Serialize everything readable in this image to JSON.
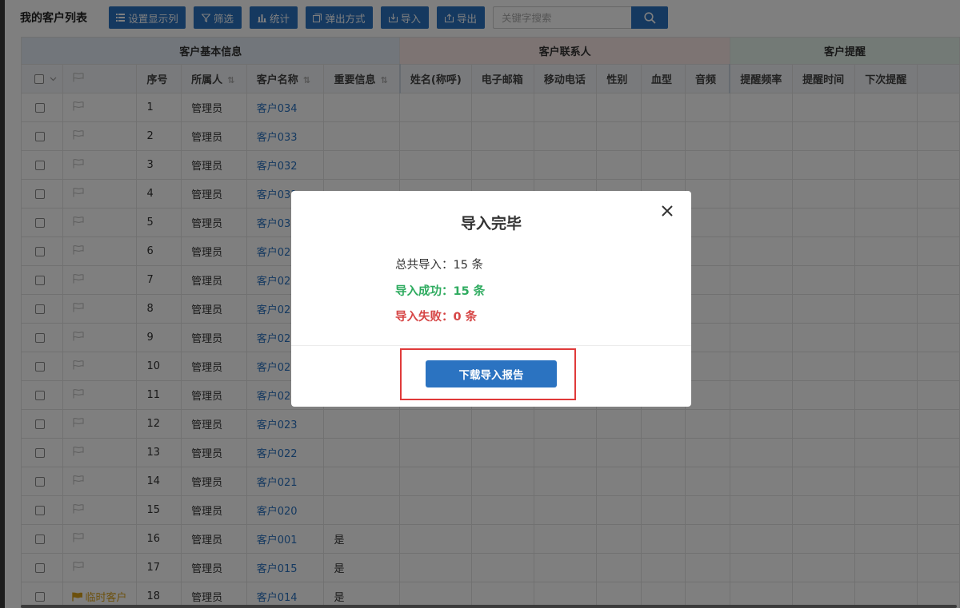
{
  "toolbar": {
    "title": "我的客户列表",
    "buttons": [
      "设置显示列",
      "筛选",
      "统计",
      "弹出方式",
      "导入",
      "导出"
    ],
    "search_placeholder": "关键字搜索"
  },
  "table": {
    "groups": [
      "客户基本信息",
      "客户联系人",
      "客户提醒"
    ],
    "columns": [
      "序号",
      "所属人",
      "客户名称",
      "重要信息",
      "姓名(称呼)",
      "电子邮箱",
      "移动电话",
      "性别",
      "血型",
      "音频",
      "提醒频率",
      "提醒时间",
      "下次提醒"
    ],
    "rows": [
      {
        "flag": "",
        "no": "1",
        "owner": "管理员",
        "name": "客户034",
        "important": ""
      },
      {
        "flag": "",
        "no": "2",
        "owner": "管理员",
        "name": "客户033",
        "important": ""
      },
      {
        "flag": "",
        "no": "3",
        "owner": "管理员",
        "name": "客户032",
        "important": ""
      },
      {
        "flag": "",
        "no": "4",
        "owner": "管理员",
        "name": "客户031",
        "important": ""
      },
      {
        "flag": "",
        "no": "5",
        "owner": "管理员",
        "name": "客户030",
        "important": ""
      },
      {
        "flag": "",
        "no": "6",
        "owner": "管理员",
        "name": "客户029",
        "important": ""
      },
      {
        "flag": "",
        "no": "7",
        "owner": "管理员",
        "name": "客户028",
        "important": ""
      },
      {
        "flag": "",
        "no": "8",
        "owner": "管理员",
        "name": "客户027",
        "important": ""
      },
      {
        "flag": "",
        "no": "9",
        "owner": "管理员",
        "name": "客户026",
        "important": ""
      },
      {
        "flag": "",
        "no": "10",
        "owner": "管理员",
        "name": "客户025",
        "important": ""
      },
      {
        "flag": "",
        "no": "11",
        "owner": "管理员",
        "name": "客户024",
        "important": ""
      },
      {
        "flag": "",
        "no": "12",
        "owner": "管理员",
        "name": "客户023",
        "important": ""
      },
      {
        "flag": "",
        "no": "13",
        "owner": "管理员",
        "name": "客户022",
        "important": ""
      },
      {
        "flag": "",
        "no": "14",
        "owner": "管理员",
        "name": "客户021",
        "important": ""
      },
      {
        "flag": "",
        "no": "15",
        "owner": "管理员",
        "name": "客户020",
        "important": ""
      },
      {
        "flag": "",
        "no": "16",
        "owner": "管理员",
        "name": "客户001",
        "important": "是"
      },
      {
        "flag": "",
        "no": "17",
        "owner": "管理员",
        "name": "客户015",
        "important": "是"
      },
      {
        "flag": "临时客户",
        "no": "18",
        "owner": "管理员",
        "name": "客户014",
        "important": "是"
      }
    ]
  },
  "colors": {
    "primary": "#2b73c1",
    "success": "#2eab5f",
    "danger": "#d64545",
    "highlight": "#e03a3a",
    "flag": "#d9a11a"
  },
  "modal": {
    "title": "导入完毕",
    "total": "总共导入：15 条",
    "success": "导入成功：15 条",
    "fail": "导入失败：0 条",
    "download_label": "下载导入报告"
  }
}
